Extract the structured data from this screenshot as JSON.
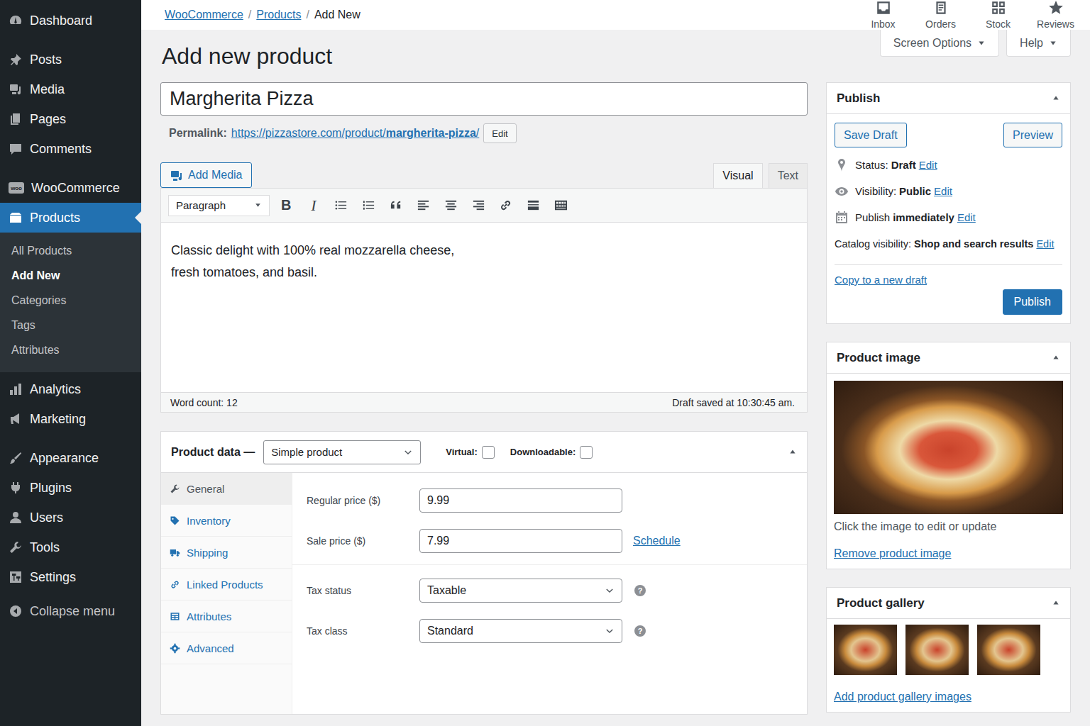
{
  "sidebar": {
    "groups": [
      [
        {
          "label": "Dashboard",
          "selected": false
        }
      ],
      [
        {
          "label": "Posts",
          "selected": false
        },
        {
          "label": "Media",
          "selected": false
        },
        {
          "label": "Pages",
          "selected": false
        },
        {
          "label": "Comments",
          "selected": false
        }
      ],
      [
        {
          "label": "WooCommerce",
          "selected": false,
          "badge": "woo"
        },
        {
          "label": "Products",
          "selected": true,
          "submenu": [
            {
              "label": "All Products",
              "selected": false
            },
            {
              "label": "Add New",
              "selected": true
            },
            {
              "label": "Categories",
              "selected": false
            },
            {
              "label": "Tags",
              "selected": false
            },
            {
              "label": "Attributes",
              "selected": false
            }
          ]
        }
      ],
      [
        {
          "label": "Analytics",
          "selected": false
        },
        {
          "label": "Marketing",
          "selected": false
        }
      ],
      [
        {
          "label": "Appearance",
          "selected": false
        },
        {
          "label": "Plugins",
          "selected": false
        },
        {
          "label": "Users",
          "selected": false
        },
        {
          "label": "Tools",
          "selected": false
        },
        {
          "label": "Settings",
          "selected": false
        }
      ]
    ],
    "collapse": "Collapse menu"
  },
  "breadcrumbs": [
    {
      "label": "WooCommerce",
      "link": true
    },
    {
      "label": "Products",
      "link": true
    },
    {
      "label": "Add New",
      "link": false
    }
  ],
  "breadcrumb_separator": "/",
  "activity": [
    "Inbox",
    "Orders",
    "Stock",
    "Reviews"
  ],
  "screen_options": "Screen Options",
  "help": "Help",
  "page_title": "Add new product",
  "product_title": "Margherita Pizza",
  "permalink": {
    "label": "Permalink:",
    "base": "https://pizzastore.com/product/",
    "slug": "margherita-pizza",
    "end": "/",
    "edit": "Edit"
  },
  "add_media": "Add Media",
  "editor": {
    "tabs": [
      {
        "label": "Visual",
        "selected": true
      },
      {
        "label": "Text",
        "selected": false
      }
    ],
    "format": "Paragraph",
    "bold": "B",
    "italic": "I",
    "content": [
      "Classic delight with 100% real mozzarella cheese,",
      "fresh tomatoes, and basil."
    ],
    "word_count": "Word count: 12",
    "saved": "Draft saved at 10:30:45 am."
  },
  "product_data": {
    "title": "Product data —",
    "type": "Simple product",
    "virtual": {
      "label": "Virtual:",
      "checked": false
    },
    "downloadable": {
      "label": "Downloadable:",
      "checked": false
    },
    "tabs": [
      {
        "label": "General",
        "selected": true
      },
      {
        "label": "Inventory",
        "selected": false
      },
      {
        "label": "Shipping",
        "selected": false
      },
      {
        "label": "Linked Products",
        "selected": false
      },
      {
        "label": "Attributes",
        "selected": false
      },
      {
        "label": "Advanced",
        "selected": false
      }
    ],
    "field_groups": [
      [
        {
          "label": "Regular price ($)",
          "value": "9.99",
          "kind": "input"
        },
        {
          "label": "Sale price ($)",
          "value": "7.99",
          "kind": "input",
          "link": "Schedule"
        }
      ],
      [
        {
          "label": "Tax status",
          "value": "Taxable",
          "kind": "select",
          "help": "?"
        },
        {
          "label": "Tax class",
          "value": "Standard",
          "kind": "select",
          "help": "?"
        }
      ]
    ]
  },
  "publish": {
    "title": "Publish",
    "save_draft": "Save Draft",
    "preview": "Preview",
    "rows": [
      {
        "label": "Status:",
        "value": "Draft",
        "edit": "Edit"
      },
      {
        "label": "Visibility:",
        "value": "Public",
        "edit": "Edit"
      },
      {
        "label": "Publish",
        "value": "immediately",
        "edit": "Edit"
      },
      {
        "label": "Catalog visibility:",
        "value": "Shop and search results",
        "edit": "Edit"
      }
    ],
    "copy": "Copy to a new draft",
    "publish": "Publish"
  },
  "product_image": {
    "title": "Product image",
    "caption": "Click the image to edit or update",
    "remove": "Remove product image"
  },
  "product_gallery": {
    "title": "Product gallery",
    "count_images": 3,
    "add": "Add product gallery images"
  }
}
